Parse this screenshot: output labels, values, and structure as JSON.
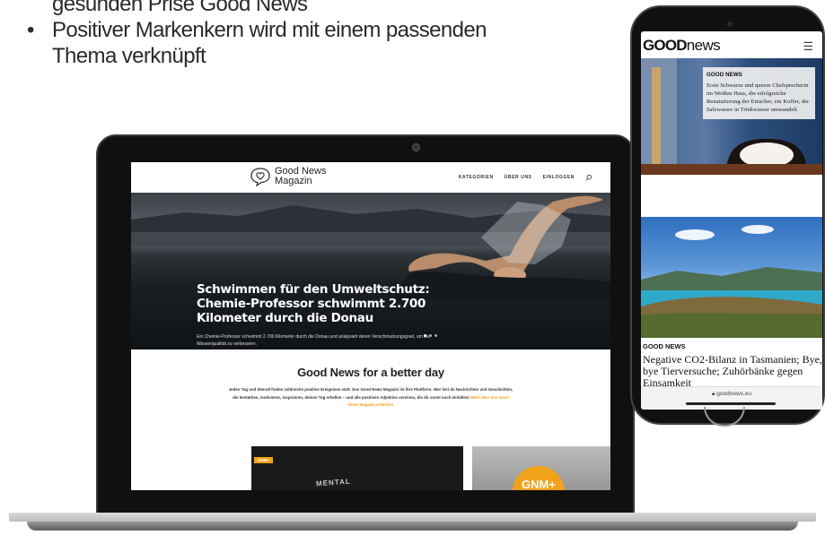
{
  "slide": {
    "bullet_1_partial": "gesunden Prise Good News",
    "bullet_2_line_1": "Positiver Markenkern wird mit einem passenden",
    "bullet_2_line_2": "Thema verknüpft",
    "bullet_symbol": "•",
    "text_color": "#2a2a2a"
  },
  "website": {
    "logo_line_1": "Good News",
    "logo_line_2": "Magazin",
    "logo_icon": "speech-heart-icon",
    "nav": [
      "KATEGORIEN",
      "ÜBER UNS",
      "EINLOGGEN"
    ],
    "search_icon": "search-icon",
    "hero": {
      "title": "Schwimmen für den Umweltschutz: Chemie-Professor schwimmt 2.700 Kilometer durch die Donau",
      "subtitle": "Ein Chemie-Professor schwimmt 2.700 Kilometer durch die Donau und analysiert deren Verschmutzungsgrad, um die Wasserqualität zu verbessern."
    },
    "tagline": "Good News for a better day",
    "tagline_body": "Jeden Tag und überall finden zahlreiche positive Ereignisse statt. Das Good News Magazin ist ihre Plattform. Hier lest du Nachrichten und Geschichten, die bestärken, motivieren, inspirieren, deinen Tag erhellen – und alle positiven Adjektive vereinen, die dir sonst noch einfallen!",
    "tagline_link": "Mehr über das Good News Magazin erfahren!",
    "card_badge": "GNM+",
    "card_left_text": "MENTAL",
    "card_right_badge": "GNM+",
    "accent_color": "#f0a31a"
  },
  "phone": {
    "logo_bold": "GOOD",
    "logo_light": "news",
    "menu_icon": "hamburger-menu-icon",
    "article_1": {
      "tag": "GOOD NEWS",
      "text": "Erste Schwarze und queere Chefsprecherin im Weißen Haus, die erfolgreiche Renaturierung der Emscher, ein Koffer, der Salzwasser in Trinkwasser umwandelt"
    },
    "article_2": {
      "tag": "GOOD NEWS",
      "headline": "Negative CO2-Bilanz in Tasmanien; Bye, bye Tierversuche; Zuhörbänke gegen Einsamkeit"
    },
    "url": "goodnews.eu",
    "lock_icon": "lock-icon"
  }
}
